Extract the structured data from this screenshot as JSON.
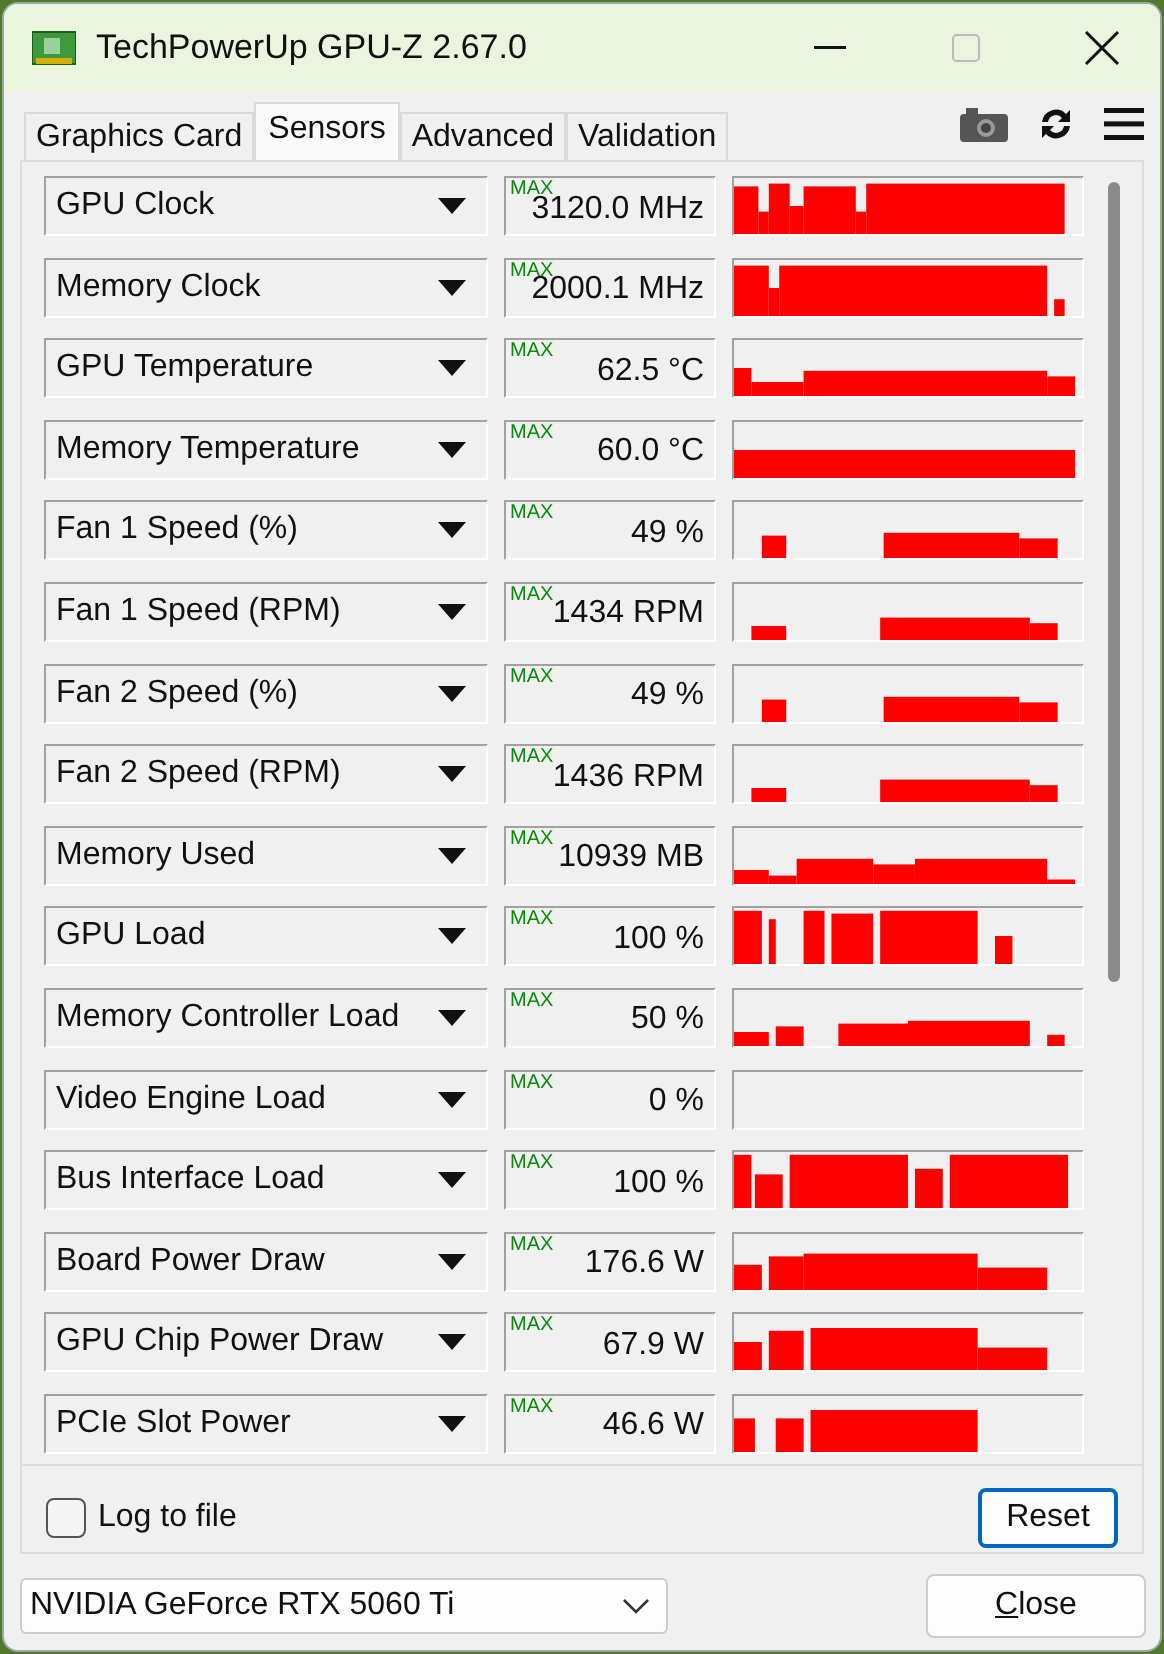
{
  "window": {
    "title": "TechPowerUp GPU-Z 2.67.0"
  },
  "tabs": [
    {
      "label": "Graphics Card",
      "selected": false
    },
    {
      "label": "Sensors",
      "selected": true
    },
    {
      "label": "Advanced",
      "selected": false
    },
    {
      "label": "Validation",
      "selected": false
    }
  ],
  "sensors": [
    {
      "name": "GPU Clock",
      "badge": "MAX",
      "value": "3120.0 MHz"
    },
    {
      "name": "Memory Clock",
      "badge": "MAX",
      "value": "2000.1 MHz"
    },
    {
      "name": "GPU Temperature",
      "badge": "MAX",
      "value": "62.5 °C"
    },
    {
      "name": "Memory Temperature",
      "badge": "MAX",
      "value": "60.0 °C"
    },
    {
      "name": "Fan 1 Speed (%)",
      "badge": "MAX",
      "value": "49 %"
    },
    {
      "name": "Fan 1 Speed (RPM)",
      "badge": "MAX",
      "value": "1434 RPM"
    },
    {
      "name": "Fan 2 Speed (%)",
      "badge": "MAX",
      "value": "49 %"
    },
    {
      "name": "Fan 2 Speed (RPM)",
      "badge": "MAX",
      "value": "1436 RPM"
    },
    {
      "name": "Memory Used",
      "badge": "MAX",
      "value": "10939 MB"
    },
    {
      "name": "GPU Load",
      "badge": "MAX",
      "value": "100 %"
    },
    {
      "name": "Memory Controller Load",
      "badge": "MAX",
      "value": "50 %"
    },
    {
      "name": "Video Engine Load",
      "badge": "MAX",
      "value": "0 %"
    },
    {
      "name": "Bus Interface Load",
      "badge": "MAX",
      "value": "100 %"
    },
    {
      "name": "Board Power Draw",
      "badge": "MAX",
      "value": "176.6 W"
    },
    {
      "name": "GPU Chip Power Draw",
      "badge": "MAX",
      "value": "67.9 W"
    },
    {
      "name": "PCIe Slot Power",
      "badge": "MAX",
      "value": "46.6 W"
    }
  ],
  "log_to_file": {
    "label": "Log to file",
    "checked": false
  },
  "reset_button": "Reset",
  "gpu_select": {
    "value": "NVIDIA GeForce RTX 5060 Ti"
  },
  "close_button": {
    "label": "Close",
    "first_letter_underlined": true
  }
}
